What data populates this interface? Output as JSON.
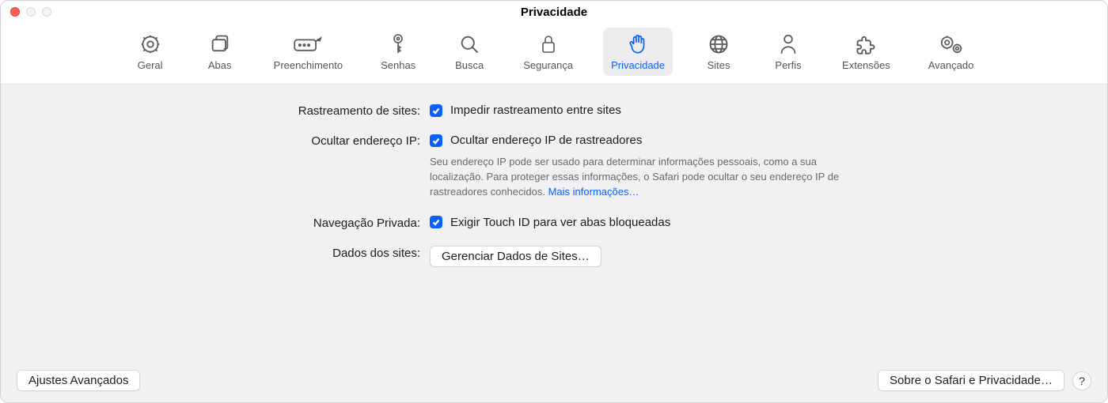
{
  "window": {
    "title": "Privacidade"
  },
  "tabs": [
    {
      "id": "geral",
      "label": "Geral"
    },
    {
      "id": "abas",
      "label": "Abas"
    },
    {
      "id": "preenchimento",
      "label": "Preenchimento"
    },
    {
      "id": "senhas",
      "label": "Senhas"
    },
    {
      "id": "busca",
      "label": "Busca"
    },
    {
      "id": "seguranca",
      "label": "Segurança"
    },
    {
      "id": "privacidade",
      "label": "Privacidade",
      "active": true
    },
    {
      "id": "sites",
      "label": "Sites"
    },
    {
      "id": "perfis",
      "label": "Perfis"
    },
    {
      "id": "extensoes",
      "label": "Extensões"
    },
    {
      "id": "avancado",
      "label": "Avançado"
    }
  ],
  "settings": {
    "tracking": {
      "label": "Rastreamento de sites:",
      "checkbox_label": "Impedir rastreamento entre sites",
      "checked": true
    },
    "hide_ip": {
      "label": "Ocultar endereço IP:",
      "checkbox_label": "Ocultar endereço IP de rastreadores",
      "checked": true,
      "description": "Seu endereço IP pode ser usado para determinar informações pessoais, como a sua localização. Para proteger essas informações, o Safari pode ocultar o seu endereço IP de rastreadores conhecidos. ",
      "more_link": "Mais informações…"
    },
    "private_browsing": {
      "label": "Navegação Privada:",
      "checkbox_label": "Exigir Touch ID para ver abas bloqueadas",
      "checked": true
    },
    "site_data": {
      "label": "Dados dos sites:",
      "button": "Gerenciar Dados de Sites…"
    }
  },
  "footer": {
    "advanced": "Ajustes Avançados",
    "about": "Sobre o Safari e Privacidade…",
    "help": "?"
  }
}
